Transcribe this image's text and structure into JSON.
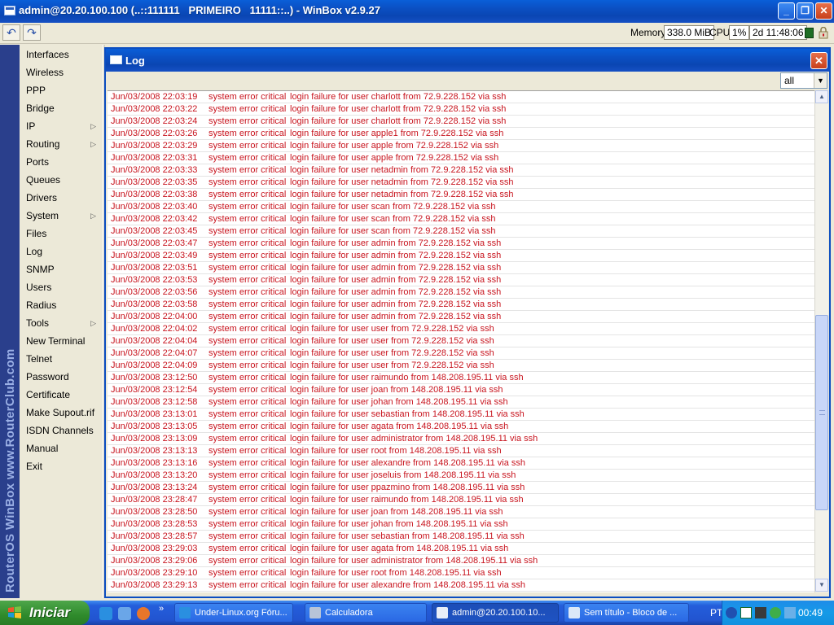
{
  "window": {
    "title": "admin@20.20.100.100 (..::111111   PRIMEIRO   11111::..) - WinBox v2.9.27"
  },
  "toolbar": {
    "memory_label": "Memory:",
    "memory_value": "338.0 MiB",
    "cpu_label": "CPU:",
    "cpu_value": "1%",
    "uptime": "2d 11:48:06"
  },
  "brand": "RouterOS WinBox   www.RouterClub.com",
  "menu": [
    {
      "label": "Interfaces",
      "submenu": false
    },
    {
      "label": "Wireless",
      "submenu": false
    },
    {
      "label": "PPP",
      "submenu": false
    },
    {
      "label": "Bridge",
      "submenu": false
    },
    {
      "label": "IP",
      "submenu": true
    },
    {
      "label": "Routing",
      "submenu": true
    },
    {
      "label": "Ports",
      "submenu": false
    },
    {
      "label": "Queues",
      "submenu": false
    },
    {
      "label": "Drivers",
      "submenu": false
    },
    {
      "label": "System",
      "submenu": true
    },
    {
      "label": "Files",
      "submenu": false
    },
    {
      "label": "Log",
      "submenu": false
    },
    {
      "label": "SNMP",
      "submenu": false
    },
    {
      "label": "Users",
      "submenu": false
    },
    {
      "label": "Radius",
      "submenu": false
    },
    {
      "label": "Tools",
      "submenu": true
    },
    {
      "label": "New Terminal",
      "submenu": false
    },
    {
      "label": "Telnet",
      "submenu": false
    },
    {
      "label": "Password",
      "submenu": false
    },
    {
      "label": "Certificate",
      "submenu": false
    },
    {
      "label": "Make Supout.rif",
      "submenu": false
    },
    {
      "label": "ISDN Channels",
      "submenu": false
    },
    {
      "label": "Manual",
      "submenu": false
    },
    {
      "label": "Exit",
      "submenu": false
    }
  ],
  "log_window": {
    "title": "Log",
    "filter_value": "all",
    "rows": [
      {
        "time": "Jun/03/2008 22:03:19",
        "topics": "system error critical",
        "message": "login failure for user charlott from 72.9.228.152 via ssh"
      },
      {
        "time": "Jun/03/2008 22:03:22",
        "topics": "system error critical",
        "message": "login failure for user charlott from 72.9.228.152 via ssh"
      },
      {
        "time": "Jun/03/2008 22:03:24",
        "topics": "system error critical",
        "message": "login failure for user charlott from 72.9.228.152 via ssh"
      },
      {
        "time": "Jun/03/2008 22:03:26",
        "topics": "system error critical",
        "message": "login failure for user apple1 from 72.9.228.152 via ssh"
      },
      {
        "time": "Jun/03/2008 22:03:29",
        "topics": "system error critical",
        "message": "login failure for user apple from 72.9.228.152 via ssh"
      },
      {
        "time": "Jun/03/2008 22:03:31",
        "topics": "system error critical",
        "message": "login failure for user apple from 72.9.228.152 via ssh"
      },
      {
        "time": "Jun/03/2008 22:03:33",
        "topics": "system error critical",
        "message": "login failure for user netadmin from 72.9.228.152 via ssh"
      },
      {
        "time": "Jun/03/2008 22:03:35",
        "topics": "system error critical",
        "message": "login failure for user netadmin from 72.9.228.152 via ssh"
      },
      {
        "time": "Jun/03/2008 22:03:38",
        "topics": "system error critical",
        "message": "login failure for user netadmin from 72.9.228.152 via ssh"
      },
      {
        "time": "Jun/03/2008 22:03:40",
        "topics": "system error critical",
        "message": "login failure for user scan from 72.9.228.152 via ssh"
      },
      {
        "time": "Jun/03/2008 22:03:42",
        "topics": "system error critical",
        "message": "login failure for user scan from 72.9.228.152 via ssh"
      },
      {
        "time": "Jun/03/2008 22:03:45",
        "topics": "system error critical",
        "message": "login failure for user scan from 72.9.228.152 via ssh"
      },
      {
        "time": "Jun/03/2008 22:03:47",
        "topics": "system error critical",
        "message": "login failure for user admin from 72.9.228.152 via ssh"
      },
      {
        "time": "Jun/03/2008 22:03:49",
        "topics": "system error critical",
        "message": "login failure for user admin from 72.9.228.152 via ssh"
      },
      {
        "time": "Jun/03/2008 22:03:51",
        "topics": "system error critical",
        "message": "login failure for user admin from 72.9.228.152 via ssh"
      },
      {
        "time": "Jun/03/2008 22:03:53",
        "topics": "system error critical",
        "message": "login failure for user admin from 72.9.228.152 via ssh"
      },
      {
        "time": "Jun/03/2008 22:03:56",
        "topics": "system error critical",
        "message": "login failure for user admin from 72.9.228.152 via ssh"
      },
      {
        "time": "Jun/03/2008 22:03:58",
        "topics": "system error critical",
        "message": "login failure for user admin from 72.9.228.152 via ssh"
      },
      {
        "time": "Jun/03/2008 22:04:00",
        "topics": "system error critical",
        "message": "login failure for user admin from 72.9.228.152 via ssh"
      },
      {
        "time": "Jun/03/2008 22:04:02",
        "topics": "system error critical",
        "message": "login failure for user user from 72.9.228.152 via ssh"
      },
      {
        "time": "Jun/03/2008 22:04:04",
        "topics": "system error critical",
        "message": "login failure for user user from 72.9.228.152 via ssh"
      },
      {
        "time": "Jun/03/2008 22:04:07",
        "topics": "system error critical",
        "message": "login failure for user user from 72.9.228.152 via ssh"
      },
      {
        "time": "Jun/03/2008 22:04:09",
        "topics": "system error critical",
        "message": "login failure for user user from 72.9.228.152 via ssh"
      },
      {
        "time": "Jun/03/2008 23:12:50",
        "topics": "system error critical",
        "message": "login failure for user raimundo from 148.208.195.11 via ssh"
      },
      {
        "time": "Jun/03/2008 23:12:54",
        "topics": "system error critical",
        "message": "login failure for user joan from 148.208.195.11 via ssh"
      },
      {
        "time": "Jun/03/2008 23:12:58",
        "topics": "system error critical",
        "message": "login failure for user johan from 148.208.195.11 via ssh"
      },
      {
        "time": "Jun/03/2008 23:13:01",
        "topics": "system error critical",
        "message": "login failure for user sebastian from 148.208.195.11 via ssh"
      },
      {
        "time": "Jun/03/2008 23:13:05",
        "topics": "system error critical",
        "message": "login failure for user agata from 148.208.195.11 via ssh"
      },
      {
        "time": "Jun/03/2008 23:13:09",
        "topics": "system error critical",
        "message": "login failure for user administrator from 148.208.195.11 via ssh"
      },
      {
        "time": "Jun/03/2008 23:13:13",
        "topics": "system error critical",
        "message": "login failure for user root from 148.208.195.11 via ssh"
      },
      {
        "time": "Jun/03/2008 23:13:16",
        "topics": "system error critical",
        "message": "login failure for user alexandre from 148.208.195.11 via ssh"
      },
      {
        "time": "Jun/03/2008 23:13:20",
        "topics": "system error critical",
        "message": "login failure for user joseluis from 148.208.195.11 via ssh"
      },
      {
        "time": "Jun/03/2008 23:13:24",
        "topics": "system error critical",
        "message": "login failure for user ppazmino from 148.208.195.11 via ssh"
      },
      {
        "time": "Jun/03/2008 23:28:47",
        "topics": "system error critical",
        "message": "login failure for user raimundo from 148.208.195.11 via ssh"
      },
      {
        "time": "Jun/03/2008 23:28:50",
        "topics": "system error critical",
        "message": "login failure for user joan from 148.208.195.11 via ssh"
      },
      {
        "time": "Jun/03/2008 23:28:53",
        "topics": "system error critical",
        "message": "login failure for user johan from 148.208.195.11 via ssh"
      },
      {
        "time": "Jun/03/2008 23:28:57",
        "topics": "system error critical",
        "message": "login failure for user sebastian from 148.208.195.11 via ssh"
      },
      {
        "time": "Jun/03/2008 23:29:03",
        "topics": "system error critical",
        "message": "login failure for user agata from 148.208.195.11 via ssh"
      },
      {
        "time": "Jun/03/2008 23:29:06",
        "topics": "system error critical",
        "message": "login failure for user administrator from 148.208.195.11 via ssh"
      },
      {
        "time": "Jun/03/2008 23:29:10",
        "topics": "system error critical",
        "message": "login failure for user root from 148.208.195.11 via ssh"
      },
      {
        "time": "Jun/03/2008 23:29:13",
        "topics": "system error critical",
        "message": "login failure for user alexandre from 148.208.195.11 via ssh"
      }
    ]
  },
  "taskbar": {
    "start_label": "Iniciar",
    "tasks": [
      {
        "label": "Under-Linux.org Fóru...",
        "icon": "ie-icon",
        "active": false
      },
      {
        "label": "Calculadora",
        "icon": "calculator-icon",
        "active": false
      },
      {
        "label": "admin@20.20.100.10...",
        "icon": "winbox-icon",
        "active": true
      },
      {
        "label": "Sem título - Bloco de ...",
        "icon": "notepad-icon",
        "active": false
      }
    ],
    "lang": "PT",
    "clock": "00:49"
  },
  "colors": {
    "log_text": "#c8141e",
    "xp_blue": "#0b4ec1",
    "start_green": "#2f8b2c"
  }
}
